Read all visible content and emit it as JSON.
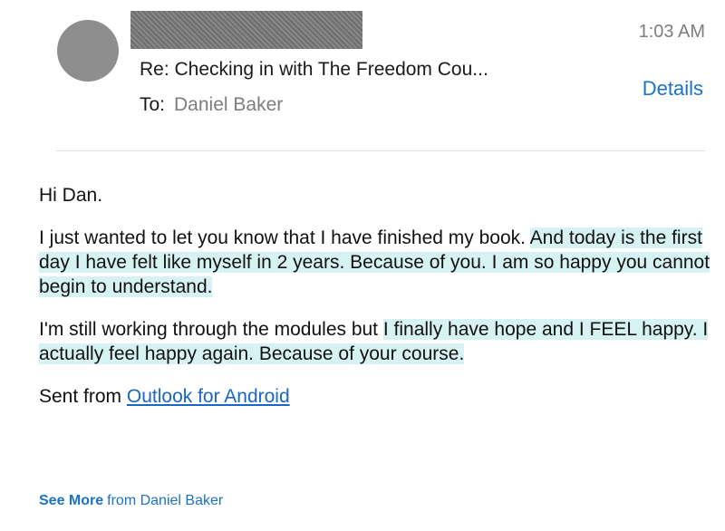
{
  "header": {
    "time": "1:03 AM",
    "subject": "Re: Checking in with The Freedom Cou...",
    "to_label": "To:",
    "to_name": "Daniel Baker",
    "details_label": "Details"
  },
  "body": {
    "greeting": "Hi Dan.",
    "p1_plain": "I just wanted to let you know that I have finished my book. ",
    "p1_highlight": "And today is the first day I have felt like myself in 2 years. Because of you. I am so happy you cannot begin to understand.",
    "p2_plain": "I'm still working through the modules but ",
    "p2_highlight": "I finally have hope and I FEEL happy. I actually feel happy again. Because of your course.",
    "signature_prefix": "Sent from ",
    "signature_link": "Outlook for Android"
  },
  "footer": {
    "see_more_label": "See More",
    "see_more_rest": "from Daniel Baker"
  },
  "colors": {
    "accent": "#1a73c8",
    "highlight": "#d6f2f3",
    "avatar": "#8e8e8e"
  }
}
